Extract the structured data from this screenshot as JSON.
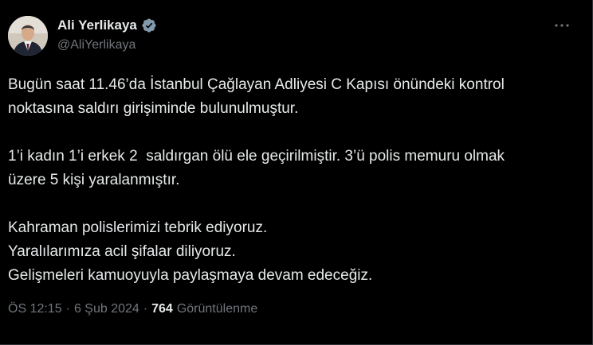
{
  "author": {
    "display_name": "Ali Yerlikaya",
    "handle": "@AliYerlikaya",
    "verified": true,
    "verified_badge_color": "#829aab",
    "avatar": "profile-photo"
  },
  "more_button": {
    "icon": "more-horizontal-icon"
  },
  "tweet": {
    "paragraphs": [
      "Bugün saat 11.46’da İstanbul Çağlayan Adliyesi C Kapısı önündeki kontrol\nnoktasına saldırı girişiminde bulunulmuştur.",
      "1’i kadın 1’i erkek 2  saldırgan ölü ele geçirilmiştir. 3’ü polis memuru olmak\nüzere 5 kişi yaralanmıştır.",
      "Kahraman polislerimizi tebrik ediyoruz.\nYaralılarımıza acil şifalar diliyoruz.\nGelişmeleri kamuoyuyla paylaşmaya devam edeceğiz."
    ]
  },
  "meta": {
    "time": "ÖS 12:15",
    "separator": "·",
    "date": "6 Şub 2024",
    "views_count": "764",
    "views_label": "Görüntülenme"
  },
  "colors": {
    "background": "#000000",
    "text_primary": "#e7e9ea",
    "text_secondary": "#71767b",
    "border": "#2f3336"
  }
}
